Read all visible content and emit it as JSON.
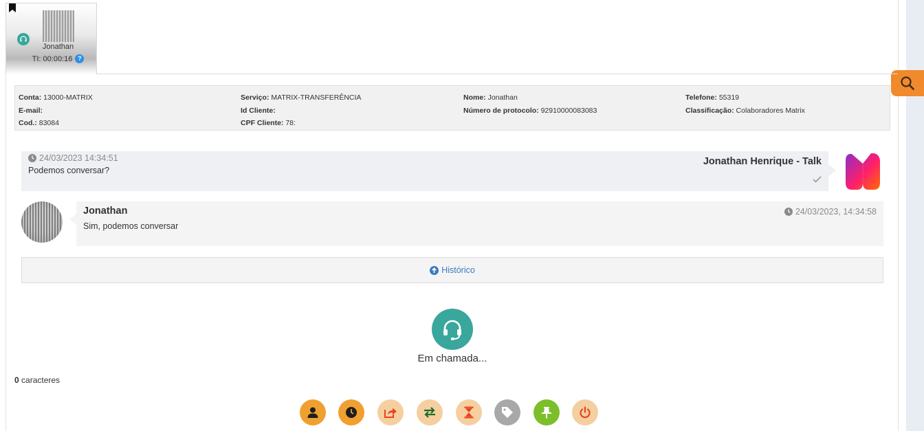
{
  "session_tab": {
    "name": "Jonathan",
    "timer": "TI: 00:00:16",
    "help_glyph": "?"
  },
  "info": {
    "conta_label": "Conta:",
    "conta_value": "13000-MATRIX",
    "email_label": "E-mail:",
    "email_value": "",
    "cod_label": "Cod.:",
    "cod_value": "83084",
    "servico_label": "Serviço:",
    "servico_value": "MATRIX-TRANSFERÊNCIA",
    "idcliente_label": "Id Cliente:",
    "idcliente_value": "",
    "cpf_label": "CPF Cliente:",
    "cpf_value": "78:",
    "nome_label": "Nome:",
    "nome_value": "Jonathan",
    "protocolo_label": "Número de protocolo:",
    "protocolo_value": "92910000083083",
    "telefone_label": "Telefone:",
    "telefone_value": "55319",
    "classificacao_label": "Classificação:",
    "classificacao_value": "Colaboradores Matrix"
  },
  "messages": [
    {
      "timestamp": "24/03/2023 14:34:51",
      "sender": "Jonathan Henrique - Talk",
      "text": "Podemos conversar?"
    },
    {
      "timestamp": "24/03/2023, 14:34:58",
      "sender": "Jonathan",
      "text": "Sim, podemos conversar"
    }
  ],
  "history": {
    "label": "Histórico"
  },
  "call": {
    "status": "Em chamada..."
  },
  "counter": {
    "count": "0",
    "label": "caracteres"
  },
  "actions": [
    {
      "name": "user-icon",
      "color": "#f0a030"
    },
    {
      "name": "clock-icon",
      "color": "#f0a030"
    },
    {
      "name": "share-icon",
      "color": "#f5cfa0"
    },
    {
      "name": "transfer-icon",
      "color": "#f5cfa0"
    },
    {
      "name": "hourglass-icon",
      "color": "#f5cfa0"
    },
    {
      "name": "tag-icon",
      "color": "#a8a8a8"
    },
    {
      "name": "pin-icon",
      "color": "#7bbf2a"
    },
    {
      "name": "power-icon",
      "color": "#f5cfa0"
    }
  ],
  "colors": {
    "accent_orange": "#f08a2c",
    "teal": "#3aa79c",
    "link_blue": "#3b7bbf"
  }
}
